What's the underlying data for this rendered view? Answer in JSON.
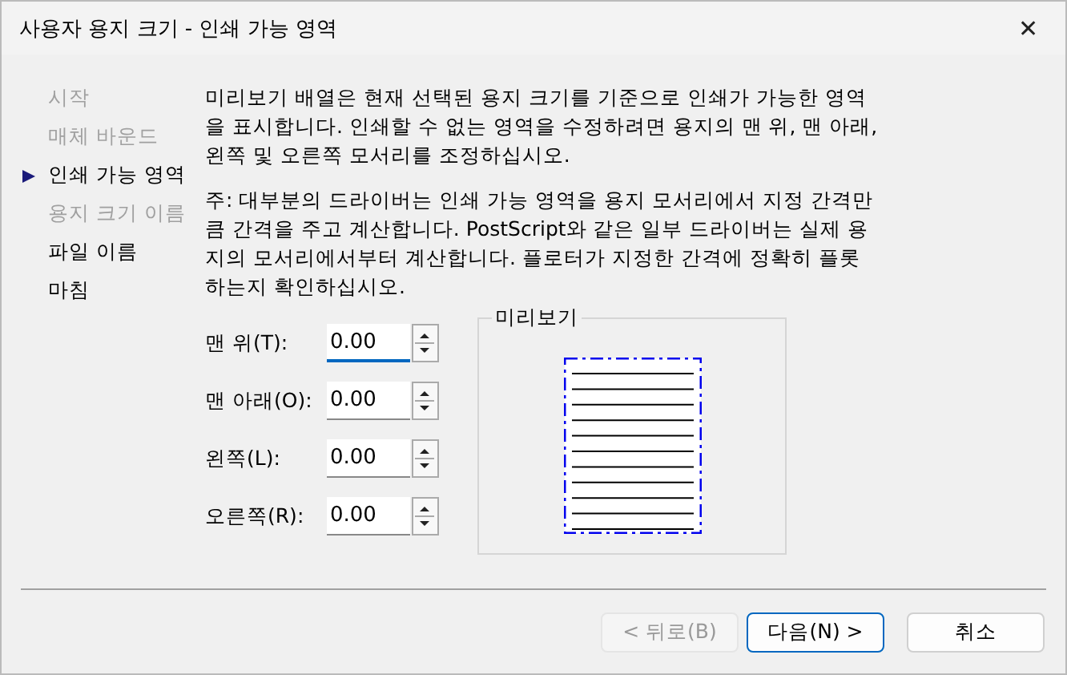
{
  "window": {
    "title": "사용자 용지 크기 - 인쇄 가능 영역",
    "close": "✕"
  },
  "steps": [
    {
      "label": "시작",
      "selected": false,
      "disabled": true
    },
    {
      "label": "매체 바운드",
      "selected": false,
      "disabled": true
    },
    {
      "label": "인쇄 가능 영역",
      "selected": true,
      "disabled": false
    },
    {
      "label": "용지 크기 이름",
      "selected": false,
      "disabled": true
    },
    {
      "label": "파일 이름",
      "selected": false,
      "disabled": false
    },
    {
      "label": "마침",
      "selected": false,
      "disabled": false
    }
  ],
  "description": [
    "미리보기 배열은 현재 선택된 용지 크기를 기준으로 인쇄가 가능한 영역을 표시합니다. 인쇄할 수 없는 영역을 수정하려면 용지의 맨 위, 맨 아래, 왼쪽 및 오른쪽 모서리를 조정하십시오.",
    "주: 대부분의 드라이버는 인쇄 가능 영역을 용지 모서리에서 지정 간격만큼 간격을 주고 계산합니다. PostScript와 같은 일부 드라이버는 실제 용지의 모서리에서부터 계산합니다. 플로터가 지정한 간격에 정확히 플롯하는지 확인하십시오."
  ],
  "fields": [
    {
      "label": "맨 위(T):",
      "value": "0.00",
      "focused": true
    },
    {
      "label": "맨 아래(O):",
      "value": "0.00",
      "focused": false
    },
    {
      "label": "왼쪽(L):",
      "value": "0.00",
      "focused": false
    },
    {
      "label": "오른쪽(R):",
      "value": "0.00",
      "focused": false
    }
  ],
  "preview": {
    "title": "미리보기"
  },
  "buttons": [
    {
      "label": "< 뒤로(B)",
      "disabled": true,
      "default": false
    },
    {
      "label": "다음(N) >",
      "disabled": false,
      "default": true
    },
    {
      "label": "취소",
      "disabled": false,
      "default": false
    }
  ]
}
